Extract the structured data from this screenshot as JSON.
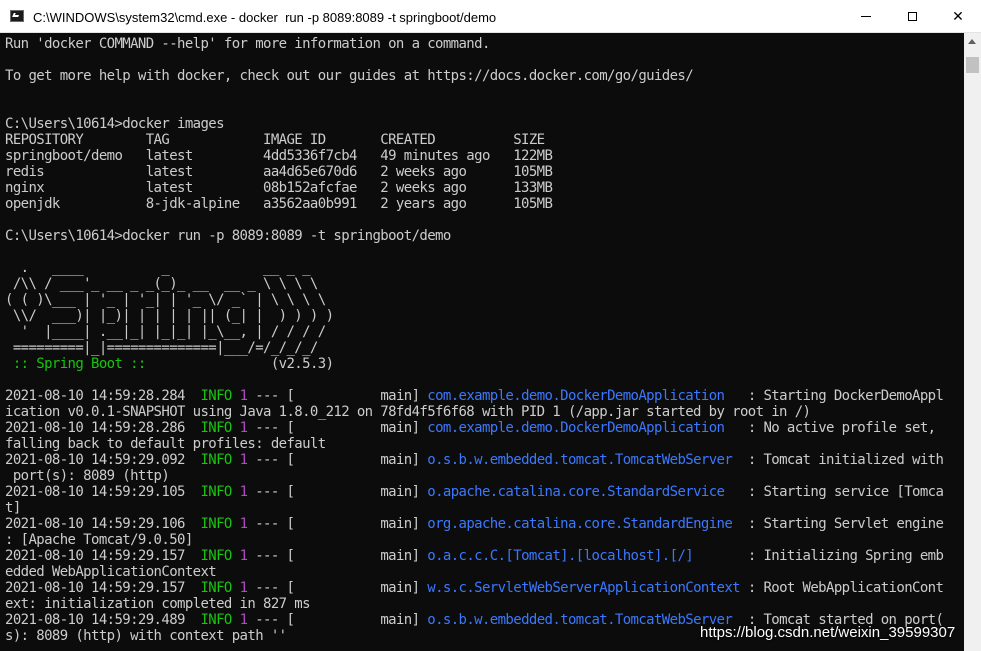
{
  "window": {
    "title": "C:\\WINDOWS\\system32\\cmd.exe - docker  run -p 8089:8089 -t springboot/demo",
    "minimize_glyph": "minimize-icon",
    "maximize_glyph": "maximize-icon",
    "close_label": "✕"
  },
  "colors": {
    "background": "#0c0c0c",
    "text": "#cccccc",
    "info_green": "#16c60c",
    "pid_magenta": "#b148c6",
    "logger_blue": "#3b78ff"
  },
  "terminal": {
    "lines": [
      "Run 'docker COMMAND --help' for more information on a command.",
      "",
      "To get more help with docker, check out our guides at https://docs.docker.com/go/guides/",
      "",
      "",
      "C:\\Users\\10614>docker images",
      "REPOSITORY        TAG            IMAGE ID       CREATED          SIZE",
      "springboot/demo   latest         4dd5336f7cb4   49 minutes ago   122MB",
      "redis             latest         aa4d65e670d6   2 weeks ago      105MB",
      "nginx             latest         08b152afcfae   2 weeks ago      133MB",
      "openjdk           8-jdk-alpine   a3562aa0b991   2 years ago      105MB",
      "",
      "C:\\Users\\10614>docker run -p 8089:8089 -t springboot/demo",
      "",
      "  .   ____          _            __ _ _",
      " /\\\\ / ___'_ __ _ _(_)_ __  __ _ \\ \\ \\ \\",
      "( ( )\\___ | '_ | '_| | '_ \\/ _` | \\ \\ \\ \\",
      " \\\\/  ___)| |_)| | | | | || (_| |  ) ) ) )",
      "  '  |____| .__|_| |_|_| |_\\__, | / / / /",
      " =========|_|==============|___/=/_/_/_/",
      " :: Spring Boot ::                (v2.5.3)",
      "",
      "2021-08-10 14:59:28.284  INFO 1 --- [           main] com.example.demo.DockerDemoApplication   : Starting DockerDemoAppl",
      "ication v0.0.1-SNAPSHOT using Java 1.8.0_212 on 78fd4f5f6f68 with PID 1 (/app.jar started by root in /)",
      "2021-08-10 14:59:28.286  INFO 1 --- [           main] com.example.demo.DockerDemoApplication   : No active profile set,",
      "falling back to default profiles: default",
      "2021-08-10 14:59:29.092  INFO 1 --- [           main] o.s.b.w.embedded.tomcat.TomcatWebServer  : Tomcat initialized with",
      " port(s): 8089 (http)",
      "2021-08-10 14:59:29.105  INFO 1 --- [           main] o.apache.catalina.core.StandardService   : Starting service [Tomca",
      "t]",
      "2021-08-10 14:59:29.106  INFO 1 --- [           main] org.apache.catalina.core.StandardEngine  : Starting Servlet engine",
      ": [Apache Tomcat/9.0.50]",
      "2021-08-10 14:59:29.157  INFO 1 --- [           main] o.a.c.c.C.[Tomcat].[localhost].[/]       : Initializing Spring emb",
      "edded WebApplicationContext",
      "2021-08-10 14:59:29.157  INFO 1 --- [           main] w.s.c.ServletWebServerApplicationContext : Root WebApplicationCont",
      "ext: initialization completed in 827 ms",
      "2021-08-10 14:59:29.489  INFO 1 --- [           main] o.s.b.w.embedded.tomcat.TomcatWebServer  : Tomcat started on port(",
      "s): 8089 (http) with context path ''"
    ]
  },
  "watermark": "https://blog.csdn.net/weixin_39599307"
}
